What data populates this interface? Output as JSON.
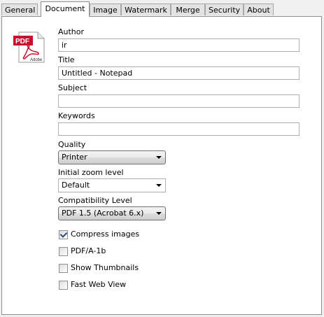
{
  "tabs": [
    "General",
    "Document",
    "Image",
    "Watermark",
    "Merge",
    "Security",
    "About"
  ],
  "active_tab": "Document",
  "icon": {
    "name": "pdf-adobe-icon",
    "badge_text": "PDF",
    "brand_text": "Adobe"
  },
  "form": {
    "author": {
      "label": "Author",
      "value": "ir"
    },
    "title": {
      "label": "Title",
      "value": "Untitled - Notepad"
    },
    "subject": {
      "label": "Subject",
      "value": ""
    },
    "keywords": {
      "label": "Keywords",
      "value": ""
    },
    "quality": {
      "label": "Quality",
      "value": "Printer"
    },
    "zoom": {
      "label": "Initial zoom level",
      "value": "Default"
    },
    "compat": {
      "label": "Compatibility Level",
      "value": "PDF 1.5 (Acrobat 6.x)"
    }
  },
  "options": [
    {
      "label": "Compress images",
      "checked": true
    },
    {
      "label": "PDF/A-1b",
      "checked": false
    },
    {
      "label": "Show Thumbnails",
      "checked": false
    },
    {
      "label": "Fast Web View",
      "checked": false
    }
  ],
  "colors": {
    "pdf_red": "#c8102e",
    "panel_bg": "#ffffff",
    "window_bg": "#f0f0f0"
  }
}
